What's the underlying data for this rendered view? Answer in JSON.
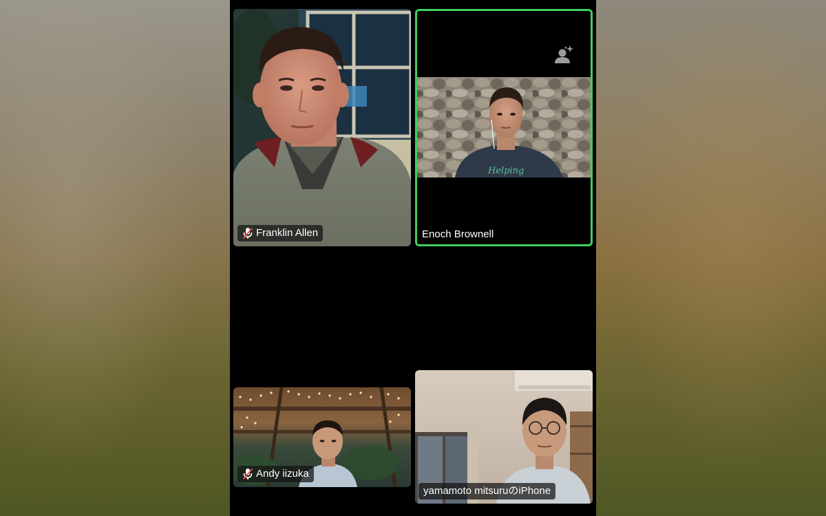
{
  "participants": [
    {
      "name": "Franklin Allen",
      "muted": true
    },
    {
      "name": "Enoch Brownell",
      "muted": false,
      "active_speaker": true
    },
    {
      "name": "Andy iizuka",
      "muted": true
    },
    {
      "name": "yamamoto mitsuruのiPhone",
      "muted": false
    }
  ],
  "feeds": {
    "enoch_shirt_text": "Helping"
  },
  "colors": {
    "active_speaker_border": "#3fcf5c",
    "background": "#000000",
    "name_tag_bg": "rgba(20,20,20,0.72)",
    "muted_mic": "#e24a3b"
  },
  "icons": {
    "muted": "mic-muted-icon",
    "spotlight": "spotlight-add-icon"
  }
}
